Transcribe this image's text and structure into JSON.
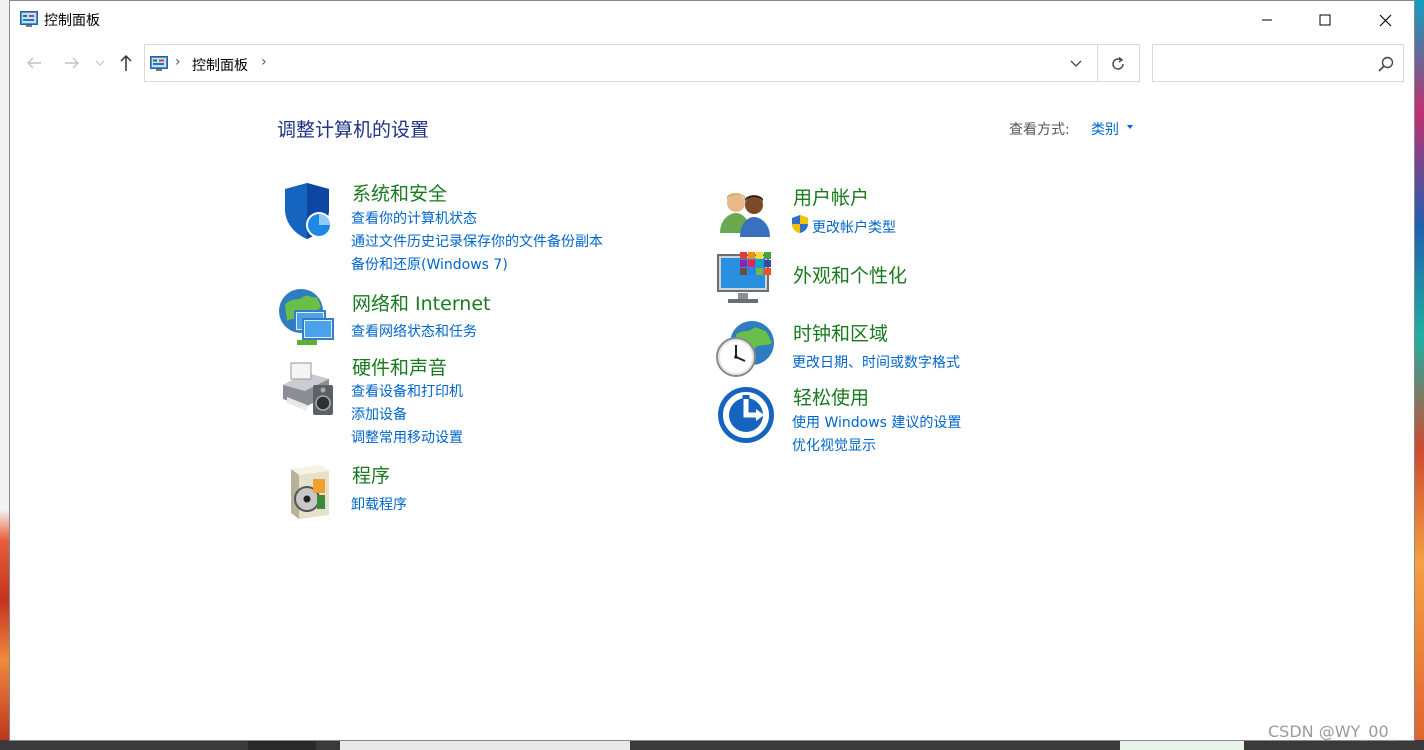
{
  "window": {
    "title": "控制面板",
    "title_icon": "control-panel-icon",
    "controls": [
      "minimize-icon",
      "maximize-icon",
      "close-icon"
    ]
  },
  "navigation": {
    "back_icon": "arrow-left-icon",
    "forward_icon": "arrow-right-icon",
    "recent_icon": "chevron-down-icon",
    "up_icon": "arrow-up-icon",
    "address": {
      "breadcrumb": "控制面板",
      "separator": "›",
      "dropdown_icon": "chevron-down-icon",
      "refresh_icon": "refresh-icon"
    },
    "search": {
      "value": "",
      "placeholder": "",
      "icon": "search-icon"
    }
  },
  "content": {
    "heading": "调整计算机的设置",
    "view_by": {
      "label": "查看方式:",
      "value": "类别"
    },
    "categories_left": [
      {
        "title": "系统和安全",
        "icon": "shield-icon",
        "links": [
          "查看你的计算机状态",
          "通过文件历史记录保存你的文件备份副本",
          "备份和还原(Windows 7)"
        ]
      },
      {
        "title": "网络和 Internet",
        "icon": "network-globe-icon",
        "links": [
          "查看网络状态和任务"
        ]
      },
      {
        "title": "硬件和声音",
        "icon": "printer-speaker-icon",
        "links": [
          "查看设备和打印机",
          "添加设备",
          "调整常用移动设置"
        ]
      },
      {
        "title": "程序",
        "icon": "programs-disc-icon",
        "links": [
          "卸载程序"
        ]
      }
    ],
    "categories_right": [
      {
        "title": "用户帐户",
        "icon": "users-icon",
        "links": [
          "更改帐户类型"
        ],
        "link_icon": "uac-shield-icon"
      },
      {
        "title": "外观和个性化",
        "icon": "monitor-palette-icon",
        "links": []
      },
      {
        "title": "时钟和区域",
        "icon": "clock-globe-icon",
        "links": [
          "更改日期、时间或数字格式"
        ]
      },
      {
        "title": "轻松使用",
        "icon": "ease-of-access-icon",
        "links": [
          "使用 Windows 建议的设置",
          "优化视觉显示"
        ]
      }
    ]
  },
  "watermark": "CSDN @WY_00_",
  "colors": {
    "heading": "#1e3287",
    "category_title": "#197a1e",
    "link": "#0066cc"
  }
}
